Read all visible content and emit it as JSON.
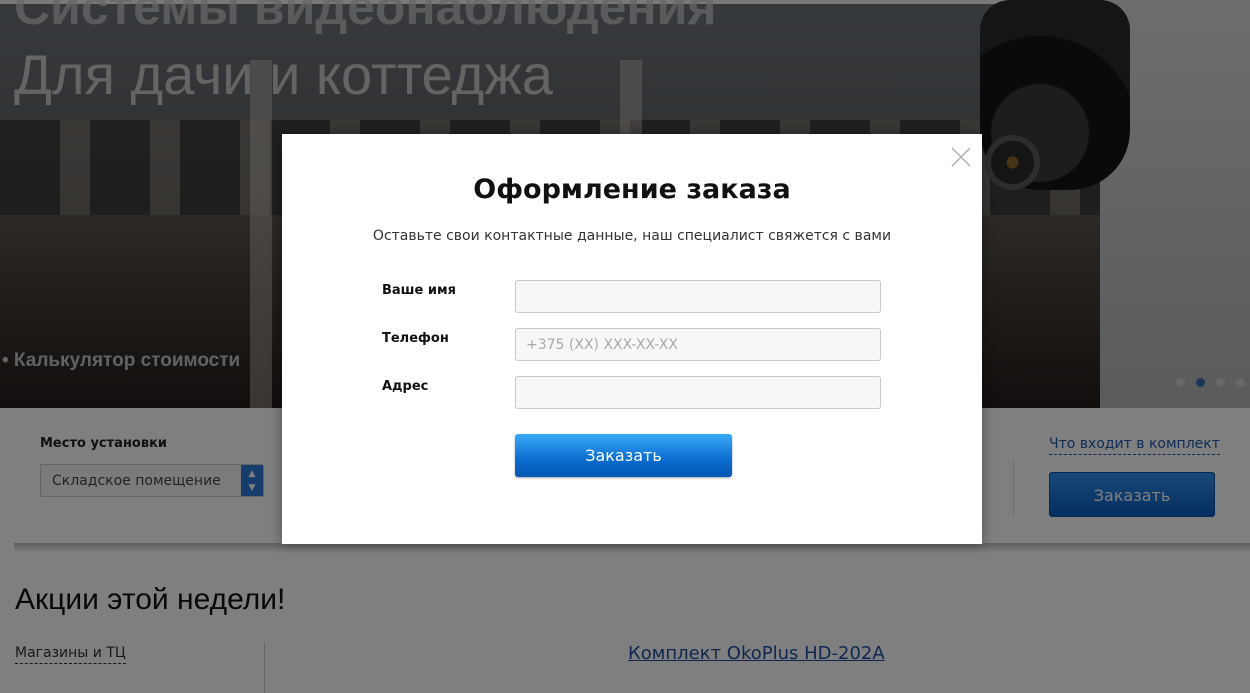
{
  "hero": {
    "title_line1": "Системы видеонаблюдения",
    "title_line2": "Для дачи и коттеджа",
    "calc_link": "• Калькулятор стоимости",
    "slider_dots": 4,
    "active_dot": 1
  },
  "calculator": {
    "install_place_label": "Место установки",
    "install_place_value": "Складское помещение",
    "kit_link": "Что входит в комплект",
    "order_button": "Заказать"
  },
  "promo": {
    "title": "Акции этой недели!",
    "category": "Магазины и ТЦ",
    "product_link": "Комплект OkoPlus HD-202A"
  },
  "modal": {
    "title": "Оформление заказа",
    "subtitle": "Оставьте свои контактные данные, наш специалист свяжется с вами",
    "fields": [
      {
        "label": "Ваше имя",
        "value": "",
        "placeholder": ""
      },
      {
        "label": "Телефон",
        "value": "",
        "placeholder": "+375 (XX) XXX-XX-XX"
      },
      {
        "label": "Адрес",
        "value": "",
        "placeholder": ""
      }
    ],
    "submit_button": "Заказать",
    "close_icon": "close-icon"
  },
  "colors": {
    "accent_blue": "#0a6cd0",
    "link_blue": "#1f5aa8",
    "overlay": "rgba(0,0,0,0.5)"
  }
}
